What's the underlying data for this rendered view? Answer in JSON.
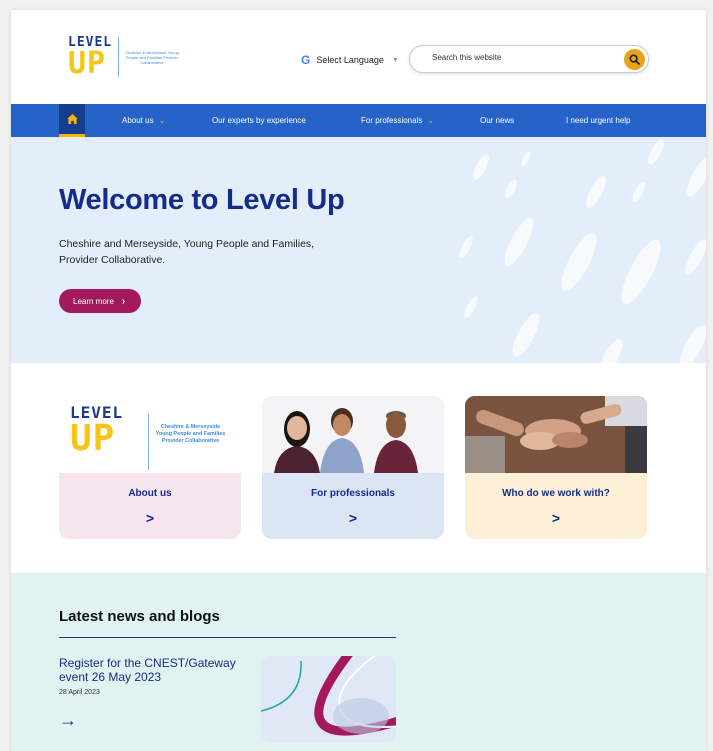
{
  "logo": {
    "word_top": "LEVEL",
    "word_bottom": "UP",
    "subtitle": "Cheshire & Merseyside Young People and Families Provider Collaborative"
  },
  "language": {
    "label": "Select Language",
    "g_icon": "G"
  },
  "search": {
    "placeholder": "Search this website"
  },
  "nav": {
    "items": [
      "About us",
      "Our experts by experience",
      "For professionals",
      "Our news",
      "I need urgent help"
    ]
  },
  "hero": {
    "title": "Welcome to Level Up",
    "body": "Cheshire and Merseyside, Young People and Families, Provider Collaborative.",
    "button": "Learn more"
  },
  "cards": [
    {
      "title": "About us",
      "bg": "#f6e4ee",
      "logo_top": "LEVEL",
      "logo_bottom": "UP",
      "logo_sub": "Cheshire & Merseyside Young People and Families Provider Collaborative"
    },
    {
      "title": "For professionals",
      "bg": "#dbe5f3"
    },
    {
      "title": "Who do we work with?",
      "bg": "#fdf0d6"
    }
  ],
  "news": {
    "heading": "Latest news and blogs",
    "article_title": "Register for the CNEST/Gateway event 26 May 2023",
    "article_date": "28 April 2023"
  },
  "colors": {
    "nav": "#2563c9",
    "accent": "#f5b400",
    "brand": "#142d8a",
    "cta": "#a3195b"
  }
}
